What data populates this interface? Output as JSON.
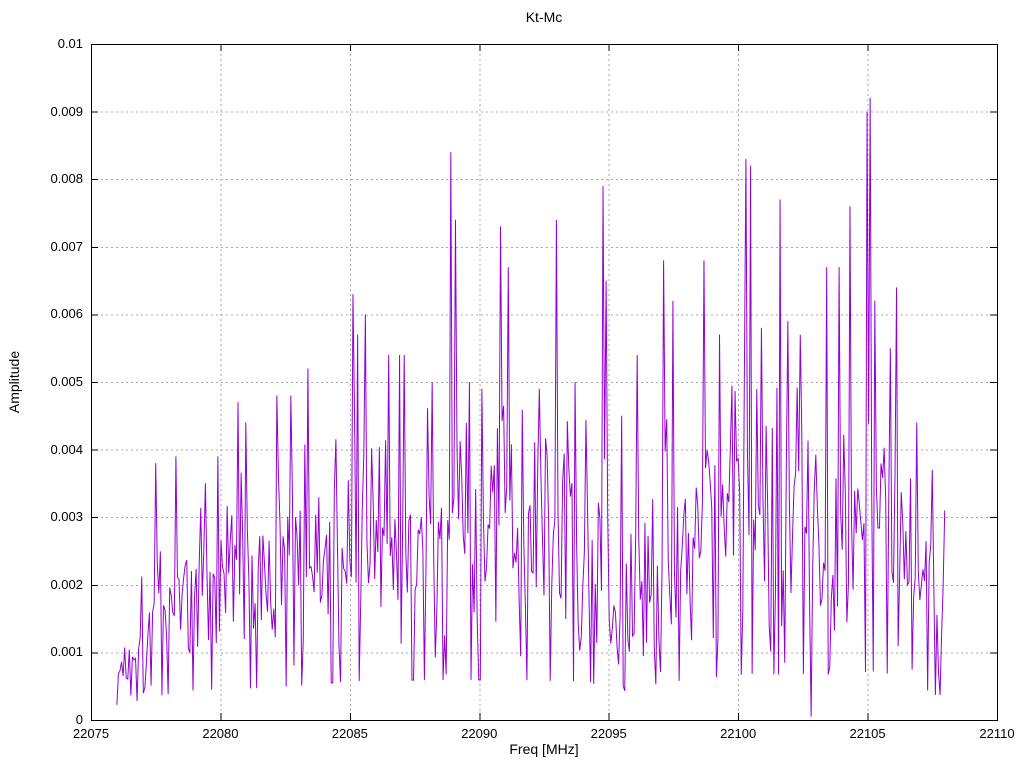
{
  "chart_data": {
    "type": "line",
    "title": "Kt-Mc",
    "xlabel": "Freq [MHz]",
    "ylabel": "Amplitude",
    "xlim": [
      22075,
      22110
    ],
    "ylim": [
      0,
      0.01
    ],
    "x_ticks": [
      22075,
      22080,
      22085,
      22090,
      22095,
      22100,
      22105,
      22110
    ],
    "x_tick_labels": [
      "22075",
      "22080",
      "22085",
      "22090",
      "22095",
      "22100",
      "22105",
      "22110"
    ],
    "y_ticks": [
      0,
      0.001,
      0.002,
      0.003,
      0.004,
      0.005,
      0.006,
      0.007,
      0.008,
      0.009,
      0.01
    ],
    "y_tick_labels": [
      "0",
      "0.001",
      "0.002",
      "0.003",
      "0.004",
      "0.005",
      "0.006",
      "0.007",
      "0.008",
      "0.009",
      "0.01"
    ],
    "grid": true,
    "legend_position": "none",
    "line_color": "#9400d3",
    "grid_color": "#a8a8a8",
    "border_color": "#000000",
    "series": [
      {
        "name": "Kt-Mc",
        "x_start": 22076.0,
        "x_end": 22108.0,
        "x_step": 0.06,
        "noise_seed": 1337,
        "noise_envelope": [
          [
            22076.0,
            0.0006,
            0.0004
          ],
          [
            22076.6,
            0.001,
            0.0006
          ],
          [
            22077.5,
            0.0016,
            0.0009
          ],
          [
            22079.0,
            0.002,
            0.0011
          ],
          [
            22081.0,
            0.0021,
            0.0012
          ],
          [
            22083.0,
            0.0023,
            0.0013
          ],
          [
            22085.0,
            0.0026,
            0.0015
          ],
          [
            22088.0,
            0.0027,
            0.0015
          ],
          [
            22091.0,
            0.0027,
            0.0015
          ],
          [
            22094.0,
            0.0026,
            0.0015
          ],
          [
            22096.0,
            0.0022,
            0.0013
          ],
          [
            22098.0,
            0.0027,
            0.0015
          ],
          [
            22100.5,
            0.0031,
            0.0017
          ],
          [
            22103.0,
            0.003,
            0.0017
          ],
          [
            22105.5,
            0.0033,
            0.0017
          ],
          [
            22106.5,
            0.0026,
            0.0014
          ],
          [
            22107.3,
            0.002,
            0.0012
          ],
          [
            22108.0,
            0.0013,
            0.0008
          ]
        ],
        "peaks": [
          [
            22077.5,
            0.0038
          ],
          [
            22078.3,
            0.0039
          ],
          [
            22079.4,
            0.0035
          ],
          [
            22079.9,
            0.0039
          ],
          [
            22080.7,
            0.0047
          ],
          [
            22081.0,
            0.0044
          ],
          [
            22082.2,
            0.0048
          ],
          [
            22082.7,
            0.0048
          ],
          [
            22083.4,
            0.0052
          ],
          [
            22085.1,
            0.0063
          ],
          [
            22085.3,
            0.0057
          ],
          [
            22085.6,
            0.006
          ],
          [
            22086.5,
            0.0054
          ],
          [
            22086.9,
            0.0054
          ],
          [
            22087.1,
            0.0054
          ],
          [
            22088.2,
            0.005
          ],
          [
            22088.9,
            0.0084
          ],
          [
            22089.1,
            0.0074
          ],
          [
            22089.6,
            0.005
          ],
          [
            22090.1,
            0.0049
          ],
          [
            22090.8,
            0.0073
          ],
          [
            22091.1,
            0.0067
          ],
          [
            22092.3,
            0.0049
          ],
          [
            22093.0,
            0.0074
          ],
          [
            22093.7,
            0.005
          ],
          [
            22094.8,
            0.0079
          ],
          [
            22094.9,
            0.0065
          ],
          [
            22095.5,
            0.0045
          ],
          [
            22096.1,
            0.0054
          ],
          [
            22097.1,
            0.0068
          ],
          [
            22097.5,
            0.0062
          ],
          [
            22098.7,
            0.0068
          ],
          [
            22099.3,
            0.0057
          ],
          [
            22100.3,
            0.0083
          ],
          [
            22100.45,
            0.0082
          ],
          [
            22100.9,
            0.0058
          ],
          [
            22101.6,
            0.0077
          ],
          [
            22101.9,
            0.0059
          ],
          [
            22102.4,
            0.0057
          ],
          [
            22103.4,
            0.0067
          ],
          [
            22103.9,
            0.0067
          ],
          [
            22104.3,
            0.0076
          ],
          [
            22105.0,
            0.009
          ],
          [
            22105.1,
            0.0092
          ],
          [
            22105.3,
            0.0062
          ],
          [
            22105.9,
            0.0055
          ],
          [
            22106.1,
            0.0064
          ],
          [
            22106.9,
            0.0044
          ],
          [
            22107.5,
            0.0037
          ],
          [
            22108.0,
            0.0031
          ]
        ],
        "dips": [
          [
            22102.8,
            5e-05
          ]
        ]
      }
    ]
  }
}
